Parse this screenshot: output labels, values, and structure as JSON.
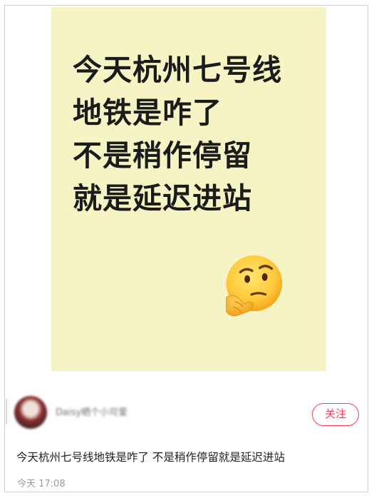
{
  "post": {
    "image": {
      "headline_lines": [
        "今天杭州七号线",
        "地铁是咋了",
        "不是稍作停留",
        "就是延迟进站"
      ],
      "emoji": "thinking-face",
      "background_color": "#f6f4c5"
    },
    "author": {
      "name": "Daisy晒个小可爱",
      "follow_label": "关注"
    },
    "caption": "今天杭州七号线地铁是咋了 不是稍作停留就是延迟进站",
    "timestamp": "今天 17:08"
  },
  "colors": {
    "accent": "#ff3b55",
    "text": "#222222",
    "muted": "#9a9a9a"
  }
}
